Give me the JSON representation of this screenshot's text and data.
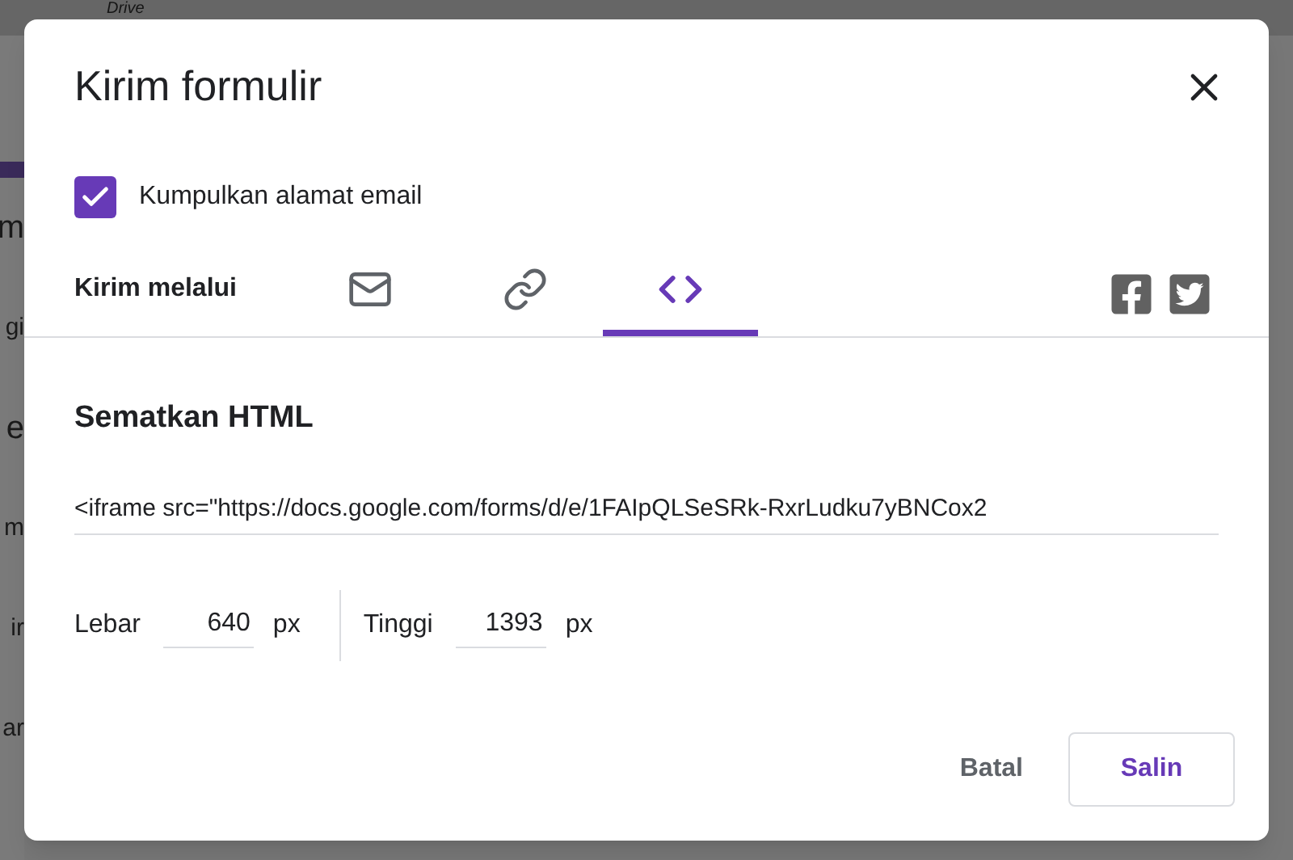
{
  "background": {
    "top_label": "Drive",
    "left_fragments": [
      {
        "text": "m",
        "kind": "heading"
      },
      {
        "text": "gi",
        "kind": "text"
      },
      {
        "text": "e",
        "kind": "heading"
      },
      {
        "text": "m",
        "kind": "text"
      },
      {
        "text": "ir",
        "kind": "text"
      },
      {
        "text": "ar",
        "kind": "text"
      }
    ]
  },
  "dialog": {
    "title": "Kirim formulir",
    "collect_email": {
      "label": "Kumpulkan alamat email",
      "checked": true
    },
    "send_via": {
      "label": "Kirim melalui",
      "tabs": [
        {
          "kind": "email",
          "selected": false
        },
        {
          "kind": "link",
          "selected": false
        },
        {
          "kind": "embed",
          "selected": true
        }
      ],
      "share": [
        {
          "kind": "facebook"
        },
        {
          "kind": "twitter"
        }
      ]
    },
    "embed": {
      "heading": "Sematkan HTML",
      "code": "<iframe src=\"https://docs.google.com/forms/d/e/1FAIpQLSeSRk-RxrLudku7yBNCox2",
      "width": {
        "label": "Lebar",
        "value": "640",
        "unit": "px"
      },
      "height": {
        "label": "Tinggi",
        "value": "1393",
        "unit": "px"
      }
    },
    "buttons": [
      {
        "kind": "text",
        "label": "Batal"
      },
      {
        "kind": "outlined",
        "label": "Salin"
      }
    ]
  }
}
